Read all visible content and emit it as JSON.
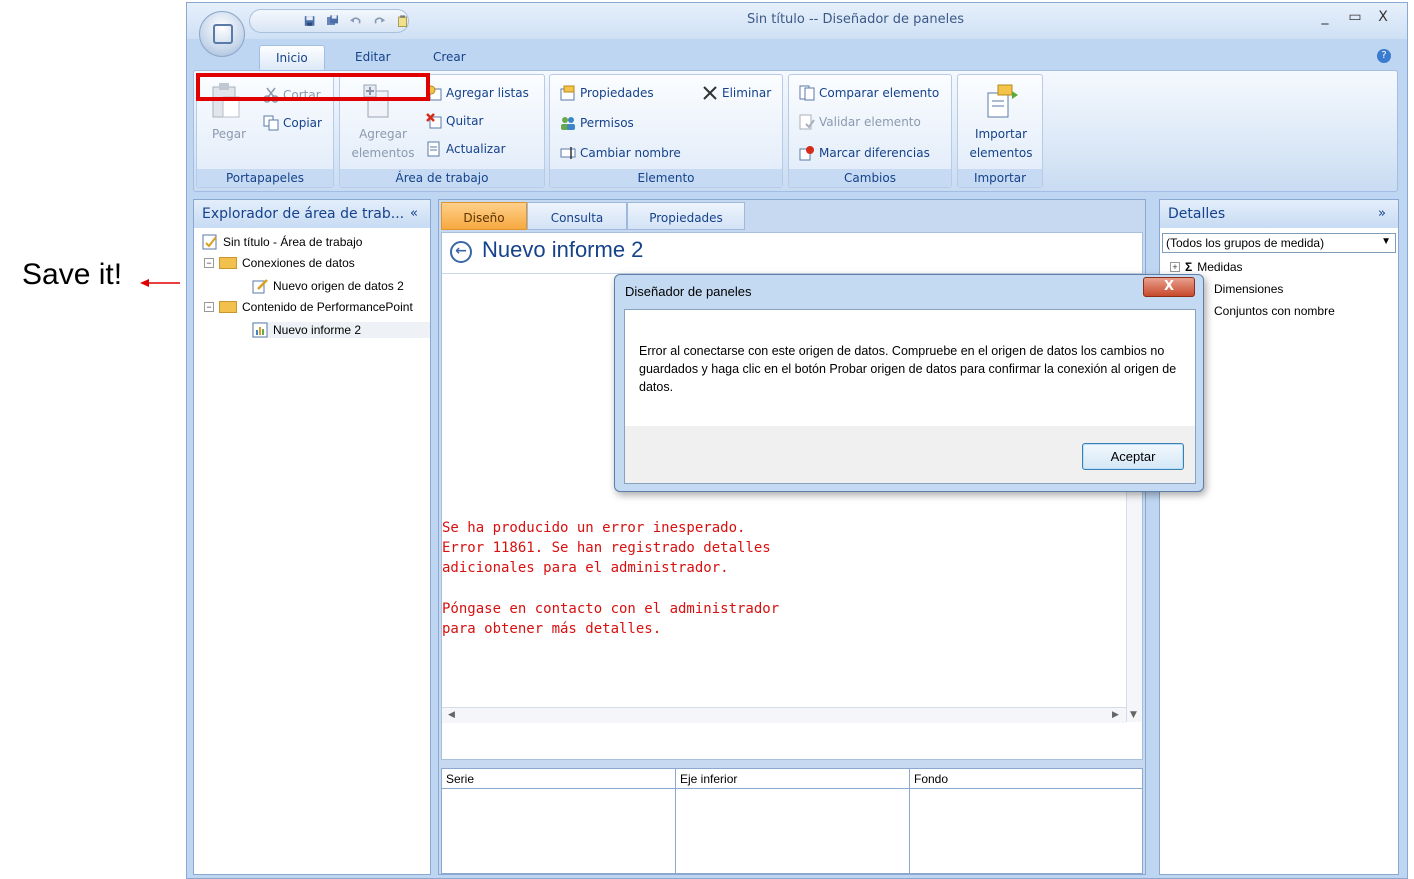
{
  "annotation": {
    "text": "Save it!"
  },
  "window": {
    "title": "Sin título -- Diseñador de paneles",
    "controls": {
      "minimize": "_",
      "maximize": "▭",
      "close": "X"
    }
  },
  "ribbon": {
    "tabs": [
      "Inicio",
      "Editar",
      "Crear"
    ],
    "groups": {
      "portapapeles": {
        "label": "Portapapeles",
        "paste": "Pegar",
        "cut": "Cortar",
        "copy": "Copiar"
      },
      "area": {
        "label": "Área de trabajo",
        "add_items_1": "Agregar",
        "add_items_2": "elementos",
        "add_lists": "Agregar listas",
        "remove": "Quitar",
        "refresh": "Actualizar"
      },
      "elemento": {
        "label": "Elemento",
        "properties": "Propiedades",
        "delete": "Eliminar",
        "permissions": "Permisos",
        "rename": "Cambiar nombre"
      },
      "cambios": {
        "label": "Cambios",
        "compare": "Comparar elemento",
        "validate": "Validar elemento",
        "mark_diff": "Marcar diferencias"
      },
      "importar": {
        "label": "Importar",
        "import_1": "Importar",
        "import_2": "elementos"
      }
    }
  },
  "explorer": {
    "title": "Explorador de área de trab...",
    "collapse": "«",
    "tree": {
      "root": "Sin título - Área de trabajo",
      "connections": "Conexiones de datos",
      "datasource": "Nuevo origen de datos 2",
      "content": "Contenido de PerformancePoint",
      "report": "Nuevo informe 2"
    }
  },
  "center": {
    "tabs": [
      "Diseño",
      "Consulta",
      "Propiedades"
    ],
    "report_title": "Nuevo informe 2",
    "error_1": "Se ha producido un error inesperado.\nError 11861. Se han registrado detalles\nadicionales para el administrador.",
    "error_2": "Póngase en contacto con el administrador\npara obtener más detalles.",
    "bottom_columns": [
      "Serie",
      "Eje inferior",
      "Fondo"
    ]
  },
  "details": {
    "title": "Detalles",
    "expand": "»",
    "select_value": "(Todos los grupos de medida)",
    "items": [
      "Medidas",
      "Dimensiones",
      "Conjuntos con nombre"
    ]
  },
  "dialog": {
    "title": "Diseñador de paneles",
    "close": "X",
    "message": "Error al conectarse con este origen de datos. Compruebe en el origen de datos los cambios no guardados y haga clic en el botón Probar origen de datos para confirmar la conexión al origen de datos.",
    "ok": "Aceptar"
  },
  "colors": {
    "ribbon_text": "#15428b",
    "error_text": "#d81010",
    "highlight_box": "#e00000",
    "active_tab": "#f7a940"
  }
}
